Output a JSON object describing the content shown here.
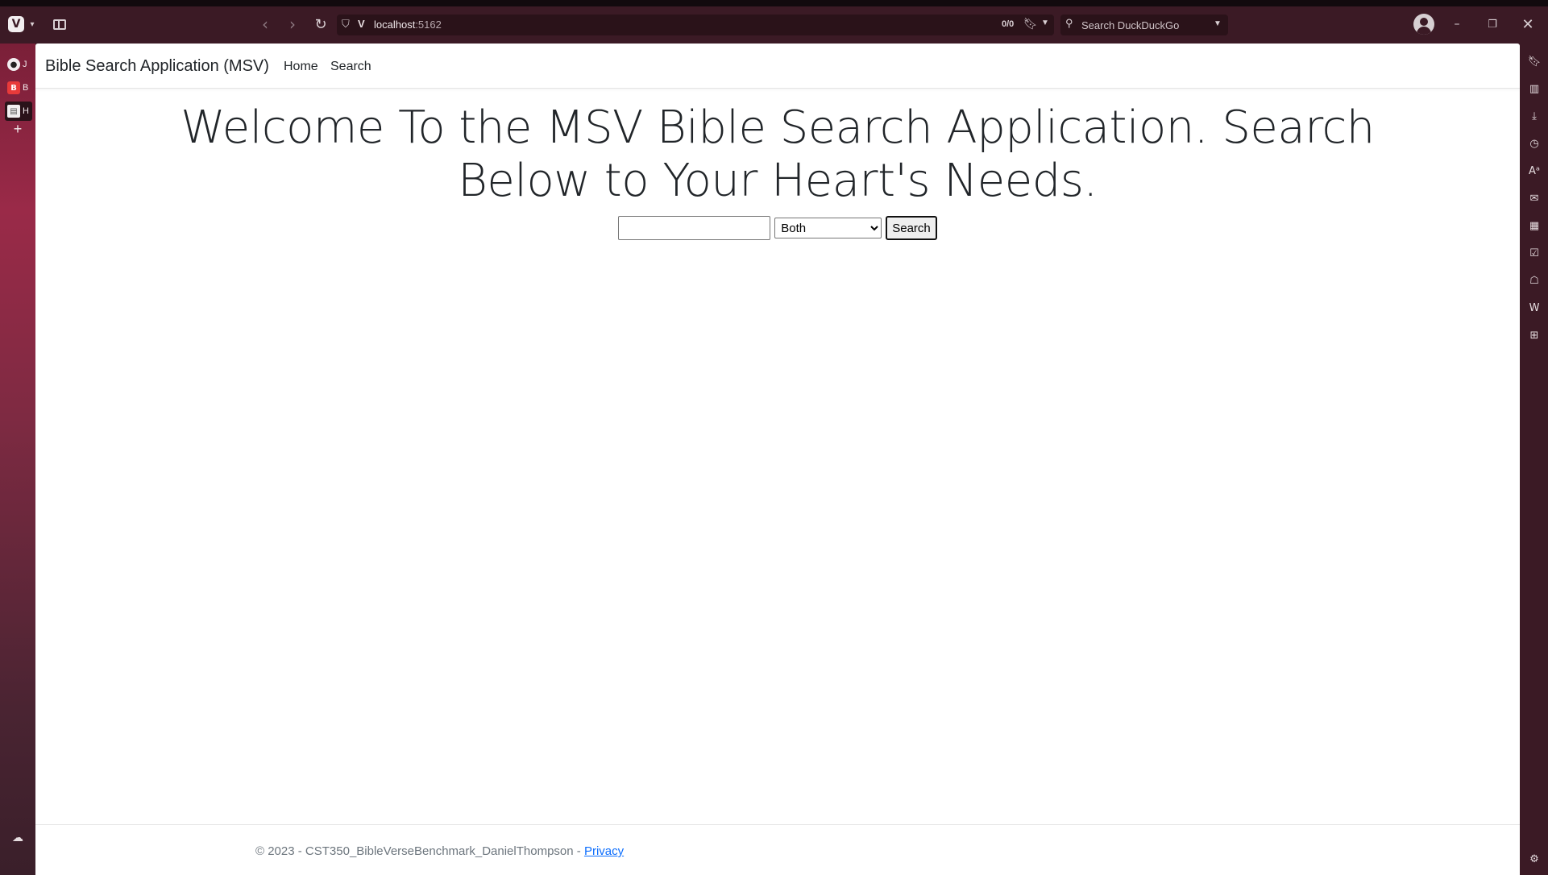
{
  "browser": {
    "url_host": "localhost",
    "url_port": ":5162",
    "match_counter": "0/0",
    "search_placeholder": "Search DuckDuckGo",
    "tabs": [
      {
        "label": "J",
        "favicon": "github-icon"
      },
      {
        "label": "B",
        "favicon": "bookmark-b-icon"
      },
      {
        "label": "H",
        "favicon": "page-icon"
      }
    ],
    "side_panel_icons": [
      "bookmarks-icon",
      "reading-list-icon",
      "downloads-icon",
      "history-icon",
      "translate-icon",
      "mail-icon",
      "calendar-icon",
      "tasks-icon",
      "feeds-icon",
      "wikipedia-icon",
      "add-panel-icon",
      "settings-icon"
    ]
  },
  "site": {
    "brand": "Bible Search Application (MSV)",
    "nav": {
      "home": "Home",
      "search": "Search"
    }
  },
  "main": {
    "heading_line1": "Welcome To the MSV Bible Search Application. Search",
    "heading_line2": "Below to Your Heart's Needs.",
    "search": {
      "input_value": "",
      "select_value": "Both",
      "select_options": [
        "Both"
      ],
      "button_label": "Search"
    }
  },
  "footer": {
    "text": "© 2023 - CST350_BibleVerseBenchmark_DanielThompson - ",
    "privacy_link": "Privacy"
  },
  "colors": {
    "chrome_bg": "#3b1a25",
    "tab_panel_accent": "#9a2a48",
    "link": "#0d6efd",
    "footer_text": "#6c757d"
  }
}
